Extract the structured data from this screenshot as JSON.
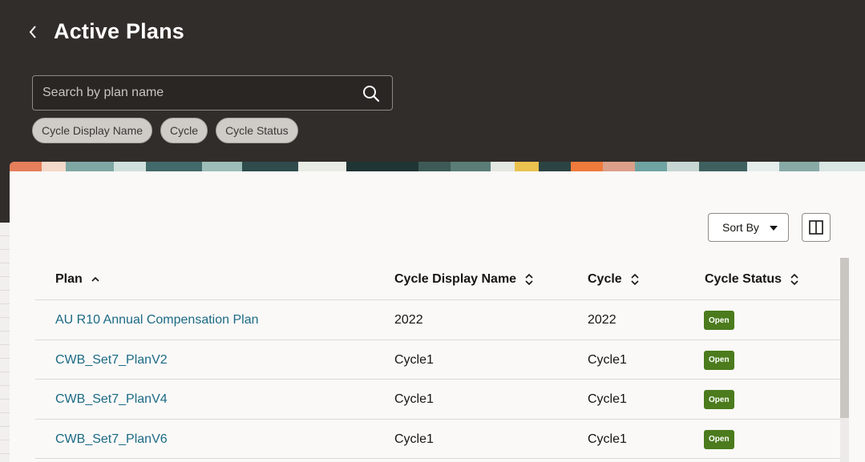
{
  "header": {
    "title": "Active Plans",
    "back_icon": "chevron-left-icon"
  },
  "search": {
    "placeholder": "Search by plan name",
    "value": "",
    "icon": "search-icon"
  },
  "filters": [
    {
      "label": "Cycle Display Name"
    },
    {
      "label": "Cycle"
    },
    {
      "label": "Cycle Status"
    }
  ],
  "toolbar": {
    "sort_label": "Sort By",
    "columns_icon": "column-layout-icon"
  },
  "table": {
    "columns": [
      {
        "label": "Plan",
        "sort": "ascending"
      },
      {
        "label": "Cycle Display Name",
        "sort": "none"
      },
      {
        "label": "Cycle",
        "sort": "none"
      },
      {
        "label": "Cycle Status",
        "sort": "none"
      }
    ],
    "rows": [
      {
        "plan": "AU R10 Annual Compensation Plan",
        "display_name": "2022",
        "cycle": "2022",
        "status": "Open"
      },
      {
        "plan": "CWB_Set7_PlanV2",
        "display_name": "Cycle1",
        "cycle": "Cycle1",
        "status": "Open"
      },
      {
        "plan": "CWB_Set7_PlanV4",
        "display_name": "Cycle1",
        "cycle": "Cycle1",
        "status": "Open"
      },
      {
        "plan": "CWB_Set7_PlanV6",
        "display_name": "Cycle1",
        "cycle": "Cycle1",
        "status": "Open"
      }
    ]
  },
  "colors": {
    "header_bg": "#312d2a",
    "link": "#1c6a84",
    "status_open": "#4b7b1d",
    "panel_bg": "#faf9f8"
  }
}
